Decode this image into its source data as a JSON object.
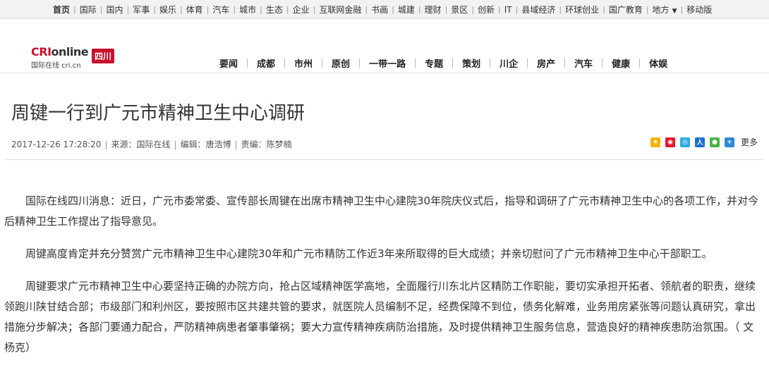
{
  "topnav": {
    "items": [
      "首页",
      "国际",
      "国内",
      "军事",
      "娱乐",
      "体育",
      "汽车",
      "城市",
      "生态",
      "企业",
      "互联网金融",
      "书画",
      "城建",
      "理财",
      "景区",
      "创新",
      "IT",
      "县域经济",
      "环球创业",
      "国广教育"
    ],
    "local_label": "地方",
    "mobile_label": "移动版"
  },
  "logo": {
    "brand_prefix": "CRI",
    "brand_suffix": "online",
    "subtitle": "国际在线 cri.cn",
    "region": "四川"
  },
  "mainnav": {
    "items": [
      "要闻",
      "成都",
      "市州",
      "原创",
      "一带一路",
      "专题",
      "策划",
      "川企",
      "房产",
      "汽车",
      "健康",
      "体娱"
    ]
  },
  "article": {
    "title": "周键一行到广元市精神卫生中心调研",
    "datetime": "2017-12-26 17:28:20",
    "source": "来源：国际在线",
    "editor": "编辑：唐浩博",
    "responsible_editor": "责编：陈梦楠",
    "share_more": "更多",
    "paragraphs": [
      "国际在线四川消息：近日，广元市委常委、宣传部长周键在出席市精神卫生中心建院30年院庆仪式后，指导和调研了广元市精神卫生中心的各项工作，并对今后精神卫生工作提出了指导意见。",
      "周键高度肯定并充分赞赏广元市精神卫生中心建院30年和广元市精防工作近3年来所取得的巨大成绩；并亲切慰问了广元市精神卫生中心干部职工。",
      "周键要求广元市精神卫生中心要坚持正确的办院方向，抢占区域精神医学高地，全面履行川东北片区精防工作职能，要切实承担开拓者、领航者的职责，继续领跑川陕甘结合部；市级部门和利州区，要按照市区共建共管的要求，就医院人员编制不足，经费保障不到位，债务化解难，业务用房紧张等问题认真研究，拿出措施分步解决；各部门要通力配合，严防精神病患者肇事肇祸；要大力宣传精神疾病防治措施，及时提供精神卫生服务信息，营造良好的精神疾患防治氛围。（ 文 杨克）"
    ]
  },
  "colors": {
    "brand_red": "#c8102e"
  }
}
